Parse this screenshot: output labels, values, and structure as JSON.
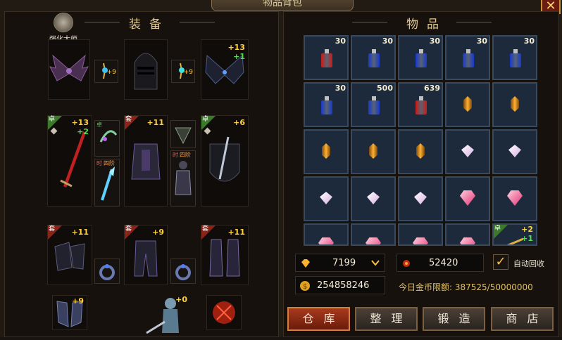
{
  "window": {
    "title": "物品背包",
    "close_icon": "close-icon"
  },
  "left": {
    "title": "装备",
    "master": {
      "label": "强化大师",
      "icon": "master-icon"
    },
    "slots": {
      "wings_plus": "+9",
      "wings2_plus1": "+13",
      "wings2_plus2": "+1",
      "weapon_tag": "卓",
      "weapon_plus1": "+13",
      "weapon_plus2": "+2",
      "armor_tag": "套",
      "armor_plus": "+11",
      "shield_tag": "卓",
      "shield_plus": "+6",
      "gloves_tag": "套",
      "gloves_plus": "+11",
      "pants_tag": "套",
      "pants_plus": "+9",
      "boots_tag": "套",
      "boots_plus": "+11",
      "acc1_plus": "+9",
      "acc2_tag1": "时",
      "acc2_tag2": "四阶",
      "acc3_tag1": "时",
      "acc3_tag2": "四阶",
      "pet1_plus": "+9",
      "pet2_plus": "+0"
    }
  },
  "right": {
    "title": "物品",
    "items": [
      {
        "kind": "potion",
        "color": "#d01818",
        "count": "30"
      },
      {
        "kind": "potion",
        "color": "#1838d0",
        "count": "30"
      },
      {
        "kind": "potion",
        "color": "#1838d0",
        "count": "30"
      },
      {
        "kind": "potion",
        "color": "#1838d0",
        "count": "30"
      },
      {
        "kind": "potion",
        "color": "#1838d0",
        "count": "30"
      },
      {
        "kind": "potion",
        "color": "#1838d0",
        "count": "30"
      },
      {
        "kind": "potion",
        "color": "#1838d0",
        "count": "500"
      },
      {
        "kind": "potion",
        "color": "#d01818",
        "count": "639"
      },
      {
        "kind": "gold-gem",
        "count": ""
      },
      {
        "kind": "gold-gem",
        "count": ""
      },
      {
        "kind": "gold-gem",
        "count": ""
      },
      {
        "kind": "gold-gem",
        "count": ""
      },
      {
        "kind": "gold-gem",
        "count": ""
      },
      {
        "kind": "white-gem",
        "count": ""
      },
      {
        "kind": "white-gem",
        "count": ""
      },
      {
        "kind": "white-gem",
        "count": ""
      },
      {
        "kind": "white-gem",
        "count": ""
      },
      {
        "kind": "white-gem",
        "count": ""
      },
      {
        "kind": "pink-gem",
        "count": ""
      },
      {
        "kind": "pink-gem",
        "count": ""
      },
      {
        "kind": "pink-gem",
        "count": ""
      },
      {
        "kind": "pink-gem",
        "count": ""
      },
      {
        "kind": "pink-gem",
        "count": ""
      },
      {
        "kind": "pink-gem",
        "count": ""
      },
      {
        "kind": "weapon",
        "tag": "卓",
        "plus1": "+2",
        "plus2": "+1",
        "count": ""
      }
    ],
    "diamond": "7199",
    "points": "52420",
    "gold": "254858246",
    "auto_recycle": "自动回收",
    "auto_recycle_checked": "✓",
    "daily_limit": "今日金币限额:  387525/50000000",
    "buttons": {
      "warehouse": "仓库",
      "sort": "整理",
      "forge": "锻造",
      "shop": "商店"
    }
  }
}
